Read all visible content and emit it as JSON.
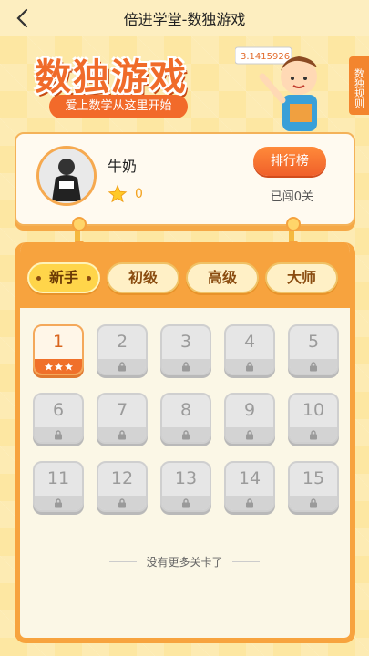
{
  "header": {
    "title": "倍进学堂-数独游戏",
    "back_icon": "chevron-left-icon"
  },
  "banner": {
    "title": "数独游戏",
    "subtitle": "爱上数学从这里开始",
    "board_text": "3.1415926",
    "rules_label": "数独规则"
  },
  "profile": {
    "name": "牛奶",
    "stars": "0",
    "rank_button": "排行榜",
    "passed": "已闯0关"
  },
  "tabs": [
    {
      "label": "新手",
      "active": true
    },
    {
      "label": "初级",
      "active": false
    },
    {
      "label": "高级",
      "active": false
    },
    {
      "label": "大师",
      "active": false
    }
  ],
  "levels": [
    {
      "n": "1",
      "unlocked": true,
      "stars": 3
    },
    {
      "n": "2",
      "unlocked": false
    },
    {
      "n": "3",
      "unlocked": false
    },
    {
      "n": "4",
      "unlocked": false
    },
    {
      "n": "5",
      "unlocked": false
    },
    {
      "n": "6",
      "unlocked": false
    },
    {
      "n": "7",
      "unlocked": false
    },
    {
      "n": "8",
      "unlocked": false
    },
    {
      "n": "9",
      "unlocked": false
    },
    {
      "n": "10",
      "unlocked": false
    },
    {
      "n": "11",
      "unlocked": false
    },
    {
      "n": "12",
      "unlocked": false
    },
    {
      "n": "13",
      "unlocked": false
    },
    {
      "n": "14",
      "unlocked": false
    },
    {
      "n": "15",
      "unlocked": false
    }
  ],
  "footer": "没有更多关卡了",
  "colors": {
    "accent": "#f0602a",
    "board": "#f7a33e",
    "background": "#fde7a2"
  }
}
